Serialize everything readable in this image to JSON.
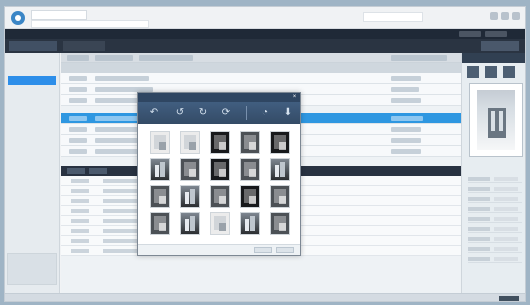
{
  "browser": {
    "tab_title": "",
    "address": "",
    "search_placeholder": ""
  },
  "app": {
    "title": "",
    "center_title": "",
    "nav_tabs": [
      "",
      ""
    ]
  },
  "sidebar": {
    "items": [
      "",
      "",
      "",
      ""
    ]
  },
  "main": {
    "grid_header": ""
  },
  "dialog": {
    "title": "",
    "close_icon": "×",
    "footer_text": "",
    "buttons": [
      "",
      ""
    ],
    "tools": [
      "↶",
      "↺",
      "↻",
      "⟳",
      "◔",
      "⬇"
    ],
    "thumbnails": [
      "light",
      "light",
      "dark2",
      "mid",
      "dark2",
      "city",
      "mid",
      "dark2",
      "mid",
      "city",
      "mid",
      "city",
      "mid",
      "dark2",
      "mid",
      "mid",
      "city",
      "light",
      "city",
      "mid"
    ]
  },
  "status": {
    "text": ""
  },
  "colors": {
    "accent": "#2d8ee9",
    "dark": "#1f2937",
    "dialog_header": "#2f4662"
  }
}
